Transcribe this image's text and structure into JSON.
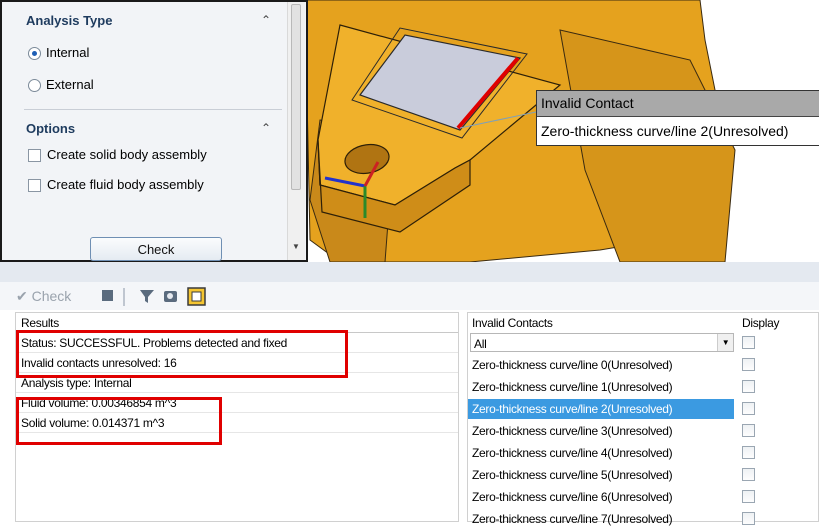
{
  "panel": {
    "analysis_type": {
      "heading": "Analysis Type",
      "options": [
        {
          "label": "Internal",
          "selected": true
        },
        {
          "label": "External",
          "selected": false
        }
      ]
    },
    "options": {
      "heading": "Options",
      "items": [
        {
          "label": "Create solid body assembly",
          "checked": false
        },
        {
          "label": "Create fluid body assembly",
          "checked": false
        }
      ]
    },
    "check_button": "Check"
  },
  "tooltip": {
    "title": "Invalid Contact",
    "body": "Zero-thickness curve/line 2(Unresolved)"
  },
  "toolbar": {
    "check_label": "Check",
    "icons": [
      "stop-icon",
      "filter-icon",
      "zoom-icon",
      "settings-icon"
    ]
  },
  "results": {
    "header": "Results",
    "rows": [
      "Status: SUCCESSFUL. Problems detected and fixed",
      "Invalid contacts unresolved: 16",
      "Analysis type: Internal",
      "Fluid volume: 0.00346854  m^3",
      "Solid volume: 0.014371  m^3"
    ]
  },
  "contacts": {
    "header": "Invalid Contacts",
    "display_header": "Display",
    "filter_value": "All",
    "items": [
      "Zero-thickness curve/line 0(Unresolved)",
      "Zero-thickness curve/line 1(Unresolved)",
      "Zero-thickness curve/line 2(Unresolved)",
      "Zero-thickness curve/line 3(Unresolved)",
      "Zero-thickness curve/line 4(Unresolved)",
      "Zero-thickness curve/line 5(Unresolved)",
      "Zero-thickness curve/line 6(Unresolved)",
      "Zero-thickness curve/line 7(Unresolved)"
    ],
    "selected_index": 2
  },
  "colors": {
    "model": "#e8a31f",
    "highlight": "#e00000",
    "selection": "#3b9ae1"
  }
}
